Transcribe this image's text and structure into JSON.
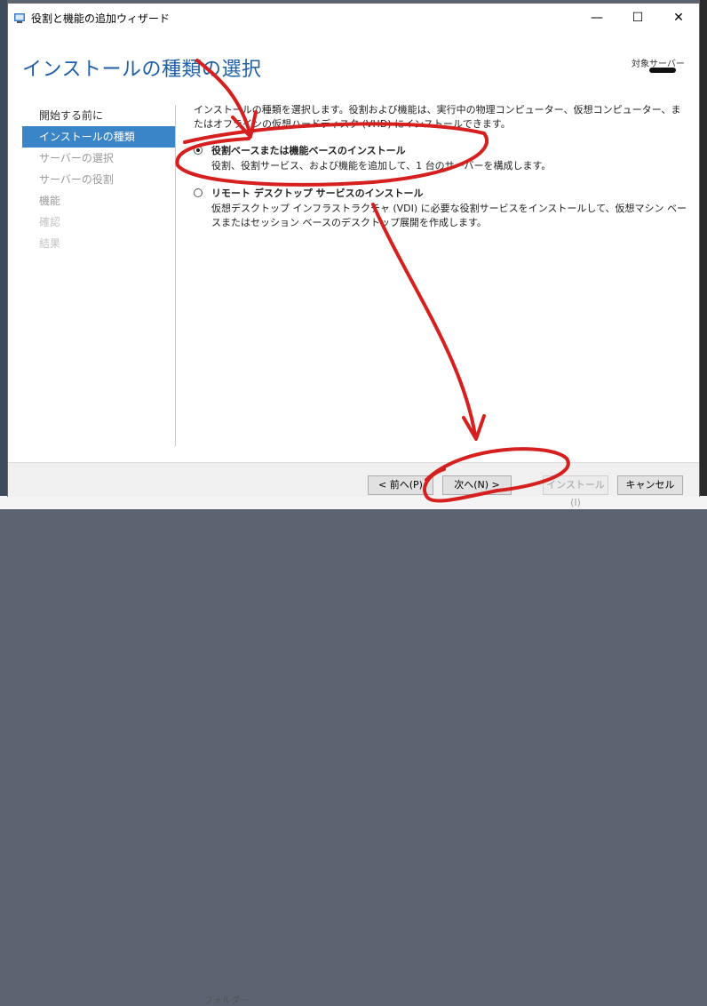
{
  "window": {
    "title": "役割と機能の追加ウィザード",
    "minimize_glyph": "—",
    "maximize_glyph": "☐",
    "close_glyph": "✕"
  },
  "header": {
    "page_title": "インストールの種類の選択",
    "target_server_label": "対象サーバー"
  },
  "nav": {
    "items": [
      {
        "label": "開始する前に",
        "state": "normal"
      },
      {
        "label": "インストールの種類",
        "state": "active"
      },
      {
        "label": "サーバーの選択",
        "state": "disabled"
      },
      {
        "label": "サーバーの役割",
        "state": "disabled"
      },
      {
        "label": "機能",
        "state": "disabled"
      },
      {
        "label": "確認",
        "state": "faint"
      },
      {
        "label": "結果",
        "state": "faint"
      }
    ]
  },
  "main": {
    "description": "インストールの種類を選択します。役割および機能は、実行中の物理コンピューター、仮想コンピューター、またはオフラインの仮想ハードディスク (VHD) にインストールできます。",
    "options": [
      {
        "title": "役割ベースまたは機能ベースのインストール",
        "description": "役割、役割サービス、および機能を追加して、1 台のサーバーを構成します。",
        "selected": true
      },
      {
        "title": "リモート デスクトップ サービスのインストール",
        "description": "仮想デスクトップ インフラストラクチャ (VDI) に必要な役割サービスをインストールして、仮想マシン ベースまたはセッション ベースのデスクトップ展開を作成します。",
        "selected": false
      }
    ]
  },
  "footer": {
    "prev_label": "< 前へ(P)",
    "next_label": "次へ(N) >",
    "install_label": "インストール(I)",
    "cancel_label": "キャンセル"
  },
  "background": {
    "bottom_text": "フォルダー"
  },
  "colors": {
    "accent": "#3a84c8",
    "title_blue": "#1e5fa8",
    "annotation_red": "#d61f1f"
  }
}
